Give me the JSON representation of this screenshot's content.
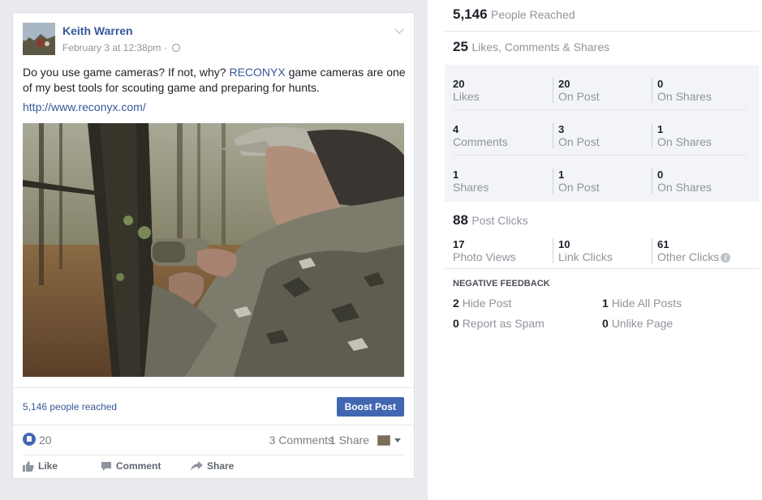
{
  "post": {
    "author": "Keith Warren",
    "timestamp": "February 3 at 12:38pm",
    "separator": "·",
    "text_before": "Do you use game cameras? If not, why? ",
    "mention": "RECONYX",
    "text_after": " game cameras are one of my best tools for scouting game and preparing for hunts.",
    "link": "http://www.reconyx.com/",
    "reach_text": "5,146 people reached",
    "boost_label": "Boost Post",
    "like_count": "20",
    "comments_count": "3 Comments",
    "shares_count": "1 Share",
    "actions": {
      "like": "Like",
      "comment": "Comment",
      "share": "Share"
    }
  },
  "stats": {
    "reached": {
      "value": "5,146",
      "label": "People Reached"
    },
    "engagement": {
      "value": "25",
      "label": "Likes, Comments & Shares"
    },
    "rows": [
      {
        "cells": [
          {
            "num": "20",
            "label": "Likes"
          },
          {
            "num": "20",
            "label": "On Post"
          },
          {
            "num": "0",
            "label": "On Shares"
          }
        ]
      },
      {
        "cells": [
          {
            "num": "4",
            "label": "Comments"
          },
          {
            "num": "3",
            "label": "On Post"
          },
          {
            "num": "1",
            "label": "On Shares"
          }
        ]
      },
      {
        "cells": [
          {
            "num": "1",
            "label": "Shares"
          },
          {
            "num": "1",
            "label": "On Post"
          },
          {
            "num": "0",
            "label": "On Shares"
          }
        ]
      }
    ],
    "clicks": {
      "value": "88",
      "label": "Post Clicks",
      "cells": [
        {
          "num": "17",
          "label": "Photo Views"
        },
        {
          "num": "10",
          "label": "Link Clicks"
        },
        {
          "num": "61",
          "label": "Other Clicks"
        }
      ]
    },
    "negative": {
      "title": "NEGATIVE FEEDBACK",
      "items": [
        {
          "num": "2",
          "label": "Hide Post"
        },
        {
          "num": "1",
          "label": "Hide All Posts"
        },
        {
          "num": "0",
          "label": "Report as Spam"
        },
        {
          "num": "0",
          "label": "Unlike Page"
        }
      ]
    }
  }
}
